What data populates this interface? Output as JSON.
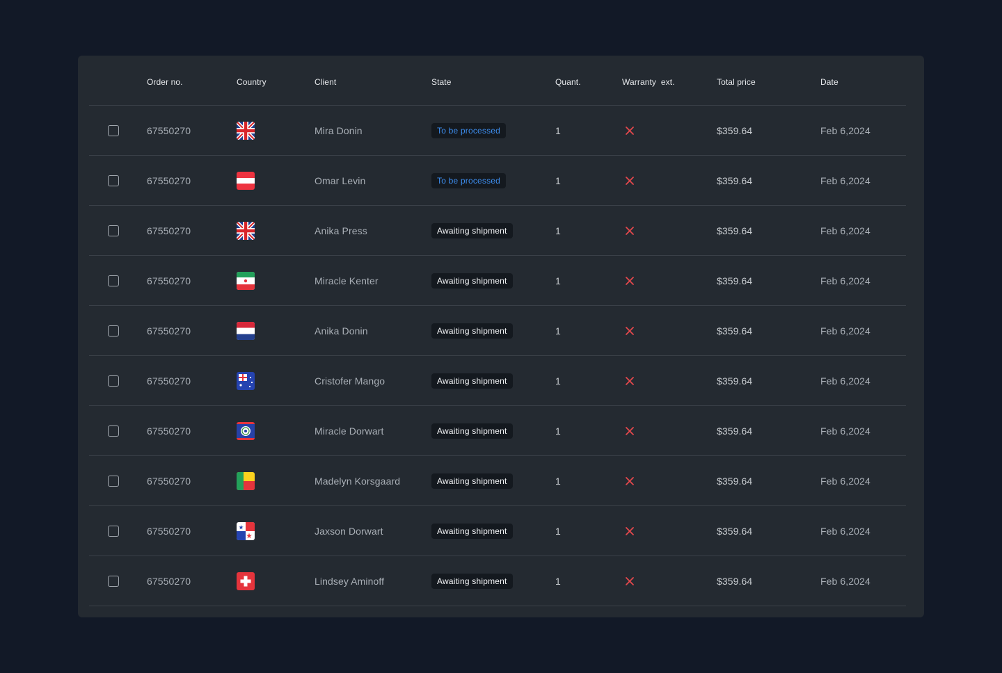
{
  "colors": {
    "page_background": "#121927",
    "card_background": "#242a31",
    "status_processing": "#3d8ef0",
    "status_awaiting": "#f3f4f6",
    "warranty_no": "#e5484d"
  },
  "headers": {
    "order_no": "Order no.",
    "country": "Country",
    "client": "Client",
    "state": "State",
    "quantity": "Quant.",
    "warranty": "Warranty  ext.",
    "total_price": "Total price",
    "date": "Date"
  },
  "rows": [
    {
      "order": "67550270",
      "flag": "uk-flag-icon",
      "client": "Mira Donin",
      "state": "To be processed",
      "state_type": "processing",
      "quantity": "1",
      "warranty": "close-icon",
      "total": "$359.64",
      "date": "Feb 6,2024"
    },
    {
      "order": "67550270",
      "flag": "austria-flag-icon",
      "client": "Omar Levin",
      "state": "To be processed",
      "state_type": "processing",
      "quantity": "1",
      "warranty": "close-icon",
      "total": "$359.64",
      "date": "Feb 6,2024"
    },
    {
      "order": "67550270",
      "flag": "uk-flag-icon",
      "client": "Anika Press",
      "state": "Awaiting shipment",
      "state_type": "awaiting",
      "quantity": "1",
      "warranty": "close-icon",
      "total": "$359.64",
      "date": "Feb 6,2024"
    },
    {
      "order": "67550270",
      "flag": "iran-flag-icon",
      "client": "Miracle Kenter",
      "state": "Awaiting shipment",
      "state_type": "awaiting",
      "quantity": "1",
      "warranty": "close-icon",
      "total": "$359.64",
      "date": "Feb 6,2024"
    },
    {
      "order": "67550270",
      "flag": "netherlands-flag-icon",
      "client": "Anika Donin",
      "state": "Awaiting shipment",
      "state_type": "awaiting",
      "quantity": "1",
      "warranty": "close-icon",
      "total": "$359.64",
      "date": "Feb 6,2024"
    },
    {
      "order": "67550270",
      "flag": "australia-flag-icon",
      "client": "Cristofer Mango",
      "state": "Awaiting shipment",
      "state_type": "awaiting",
      "quantity": "1",
      "warranty": "close-icon",
      "total": "$359.64",
      "date": "Feb 6,2024"
    },
    {
      "order": "67550270",
      "flag": "belize-flag-icon",
      "client": "Miracle Dorwart",
      "state": "Awaiting shipment",
      "state_type": "awaiting",
      "quantity": "1",
      "warranty": "close-icon",
      "total": "$359.64",
      "date": "Feb 6,2024"
    },
    {
      "order": "67550270",
      "flag": "benin-flag-icon",
      "client": "Madelyn Korsgaard",
      "state": "Awaiting shipment",
      "state_type": "awaiting",
      "quantity": "1",
      "warranty": "close-icon",
      "total": "$359.64",
      "date": "Feb 6,2024"
    },
    {
      "order": "67550270",
      "flag": "panama-flag-icon",
      "client": "Jaxson Dorwart",
      "state": "Awaiting shipment",
      "state_type": "awaiting",
      "quantity": "1",
      "warranty": "close-icon",
      "total": "$359.64",
      "date": "Feb 6,2024"
    },
    {
      "order": "67550270",
      "flag": "switzerland-flag-icon",
      "client": "Lindsey Aminoff",
      "state": "Awaiting shipment",
      "state_type": "awaiting",
      "quantity": "1",
      "warranty": "close-icon",
      "total": "$359.64",
      "date": "Feb 6,2024"
    }
  ]
}
